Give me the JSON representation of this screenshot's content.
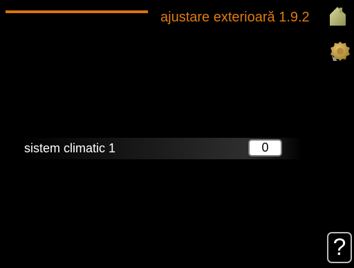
{
  "header": {
    "title": "ajustare exterioară 1.9.2"
  },
  "icons": {
    "home": "house-icon",
    "settings": "gear-icon"
  },
  "settings": {
    "row_label": "sistem climatic 1",
    "row_value": "0"
  },
  "help": {
    "label": "?"
  },
  "colors": {
    "accent": "#e07a10",
    "background": "#000000",
    "text": "#ffffff"
  }
}
